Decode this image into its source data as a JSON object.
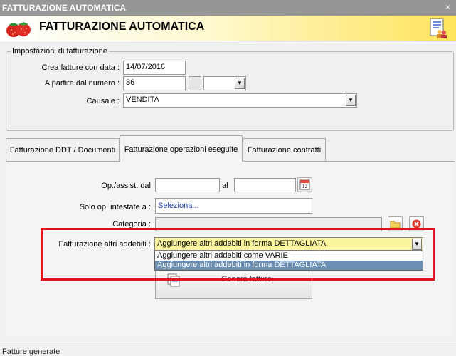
{
  "window": {
    "title": "FATTURAZIONE AUTOMATICA",
    "close_glyph": "×"
  },
  "header": {
    "title": "FATTURAZIONE AUTOMATICA",
    "logo_icon": "strawberries-icon",
    "right_icon": "users-report-icon"
  },
  "settings": {
    "legend": "Impostazioni di fatturazione",
    "date_label": "Crea fatture con data :",
    "date_value": "14/07/2016",
    "number_label": "A partire dal numero :",
    "number_value": "36",
    "number_suffix_value": "",
    "causale_label": "Causale :",
    "causale_value": "VENDITA"
  },
  "tabs": [
    {
      "label": "Fatturazione DDT / Documenti",
      "active": false
    },
    {
      "label": "Fatturazione operazioni eseguite",
      "active": true
    },
    {
      "label": "Fatturazione contratti",
      "active": false
    }
  ],
  "operations": {
    "from_label": "Op./assist. dal",
    "from_value": "",
    "to_label": "al",
    "to_value": "",
    "intestate_label": "Solo op. intestate a :",
    "intestate_value": "Seleziona...",
    "categoria_label": "Categoria :",
    "categoria_value": "",
    "altri_label": "Fatturazione altri addebiti :",
    "altri_value": "Aggiungere altri addebiti in forma DETTAGLIATA",
    "altri_options": [
      "Aggiungere altri addebiti come VARIE",
      "Aggiungere altri addebiti in forma DETTAGLIATA"
    ],
    "altri_selected_index": 1,
    "generate_label": "Genera fatture"
  },
  "footer": {
    "text": "Fatture generate"
  },
  "colors": {
    "highlight_frame": "#e0141a",
    "combo_yellow": "#fbf5a0",
    "selection": "#6b8fb3"
  }
}
